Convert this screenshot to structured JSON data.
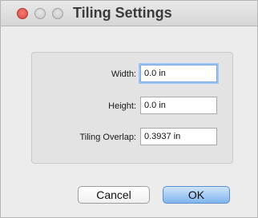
{
  "window": {
    "title": "Tiling Settings"
  },
  "title_bar": {
    "buttons": [
      {
        "name": "close",
        "color": "#e0483e"
      },
      {
        "name": "minimize",
        "color": "#cfcfcf"
      },
      {
        "name": "zoom",
        "color": "#cfcfcf"
      }
    ]
  },
  "fields": {
    "width": {
      "label": "Width:",
      "value": "0.0 in"
    },
    "height": {
      "label": "Height:",
      "value": "0.0 in"
    },
    "tiling_overlap": {
      "label": "Tiling Overlap:",
      "value": "0.3937 in"
    }
  },
  "buttons": {
    "cancel_label": "Cancel",
    "ok_label": "OK"
  }
}
